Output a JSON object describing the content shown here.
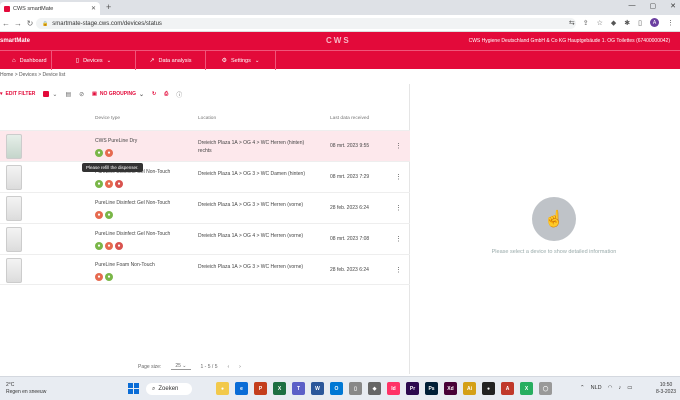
{
  "browser": {
    "tab_title": "CWS smartMate",
    "url": "smartmate-stage.cws.com/devices/status",
    "avatar_letter": "A"
  },
  "app": {
    "brand": "smartMate",
    "logo": "CWS",
    "company": "CWS Hygiene Deutschland GmbH & Co KG Hauptgebäude 1. OG Toilettes (67400000042)",
    "nav": [
      {
        "label": "Dashboard",
        "icon": "home-icon"
      },
      {
        "label": "Devices",
        "icon": "devices-icon"
      },
      {
        "label": "Data analysis",
        "icon": "chart-icon"
      },
      {
        "label": "Settings",
        "icon": "settings-icon"
      }
    ],
    "accent": "#e30a3a"
  },
  "breadcrumb": "Home  >  Devices  >  Device list",
  "toolbar": {
    "edit_filter": "EDIT FILTER",
    "no_grouping": "NO GROUPING"
  },
  "table": {
    "headers": {
      "device_type": "Device type",
      "location": "Location",
      "last_data": "Last data received"
    },
    "rows": [
      {
        "type": "CWS PureLine Dry",
        "location": "Dreieich Plaza 1A > OG 4 > WC Herren (hinten) rechts",
        "date": "08 mrt. 2023 9:55",
        "badges": [
          "g",
          "o"
        ],
        "selected": true
      },
      {
        "type": "PureLine Disinfect Gel Non-Touch",
        "location": "Dreieich Plaza 1A > OG 3 > WC Damen (hinten)",
        "date": "08 mrt. 2023 7:29",
        "badges": [
          "g",
          "o",
          "r"
        ],
        "selected": false
      },
      {
        "type": "PureLine Disinfect Gel Non-Touch",
        "location": "Dreieich Plaza 1A > OG 3 > WC Herren (vorne)",
        "date": "28 feb. 2023 6:24",
        "badges": [
          "o",
          "g"
        ],
        "selected": false
      },
      {
        "type": "PureLine Disinfect Gel Non-Touch",
        "location": "Dreieich Plaza 1A > OG 4 > WC Herren (vorne)",
        "date": "08 mrt. 2023 7:08",
        "badges": [
          "g",
          "o",
          "r"
        ],
        "selected": false
      },
      {
        "type": "PureLine Foam Non-Touch",
        "location": "Dreieich Plaza 1A > OG 3 > WC Herren (vorne)",
        "date": "28 feb. 2023 6:24",
        "badges": [
          "o",
          "g"
        ],
        "selected": false
      }
    ],
    "tooltip": "Please refill the dispenser."
  },
  "pager": {
    "label": "Page size:",
    "size": "25",
    "range": "1 - 5 / 5"
  },
  "detail": {
    "placeholder": "Please select a device to show detailed information"
  },
  "taskbar": {
    "temp": "2°C",
    "weather": "Regen en sneeuw",
    "search": "Zoeken",
    "lang": "NLD",
    "time": "10:50",
    "date": "8-3-2023"
  }
}
